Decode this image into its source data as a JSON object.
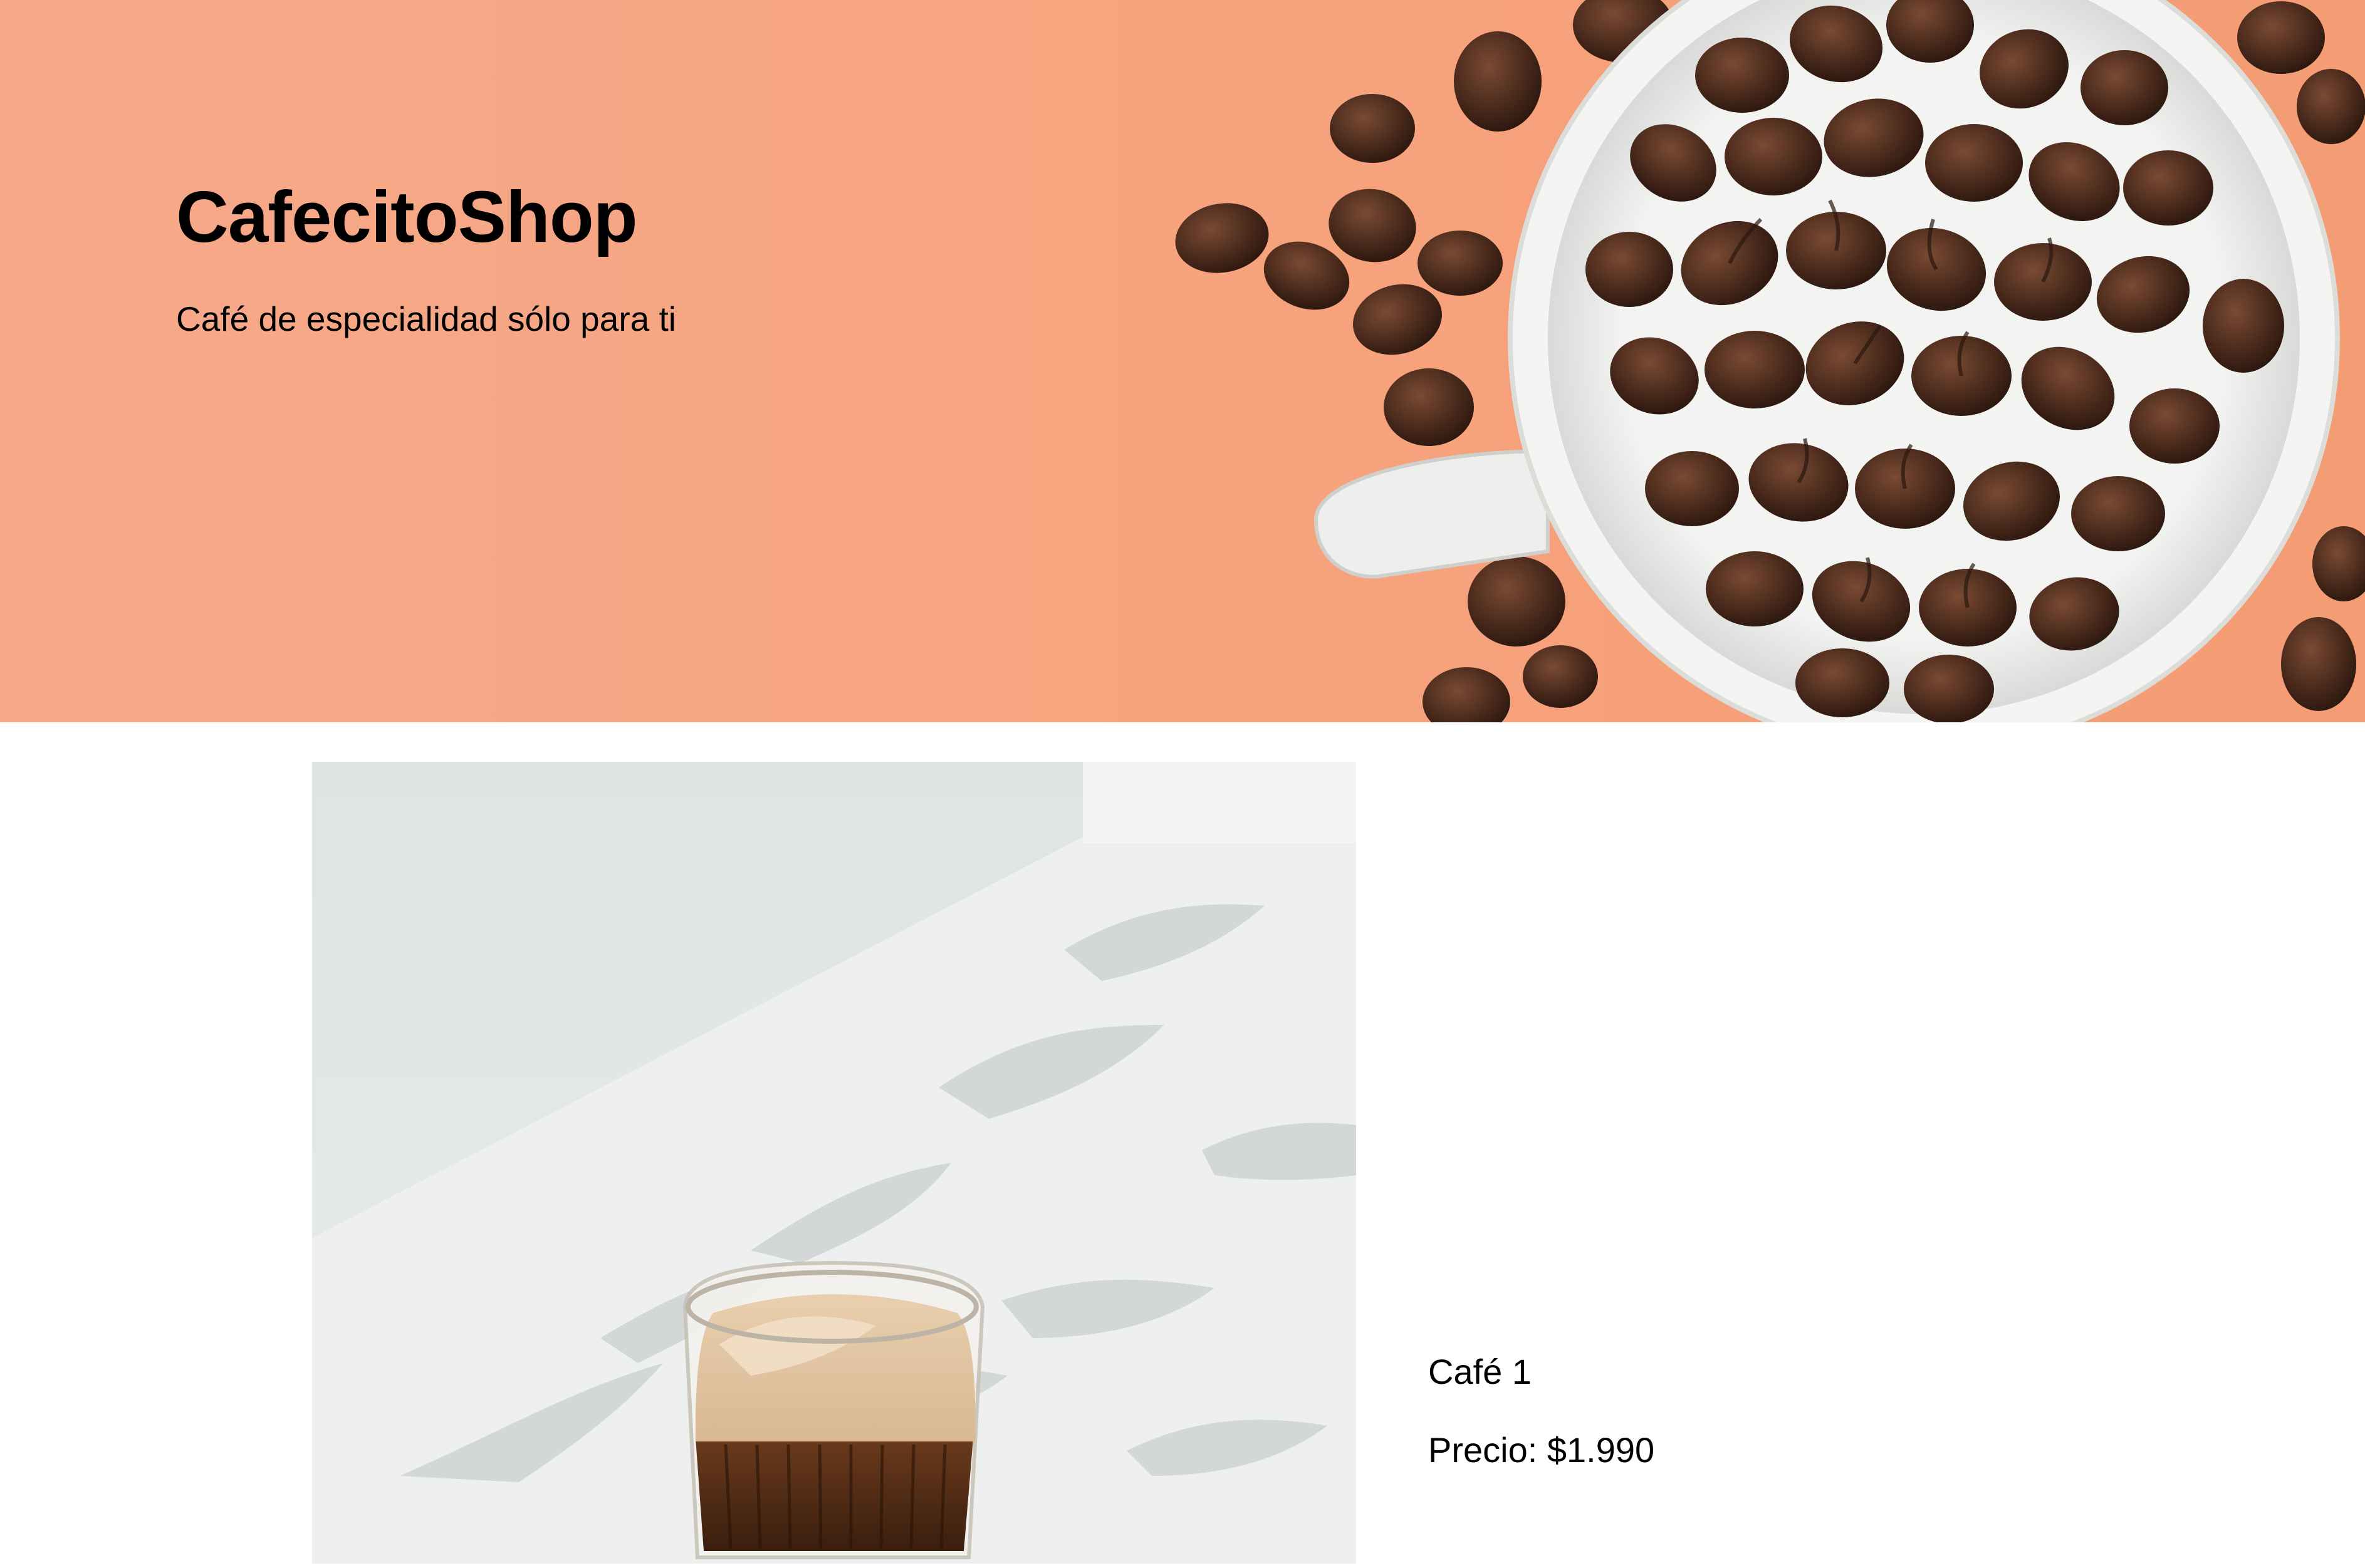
{
  "hero": {
    "title": "CafecitoShop",
    "subtitle": "Café de especialidad sólo para ti",
    "background_color": "#f6a582",
    "image": "coffee-beans-cup-image"
  },
  "product": {
    "image": "iced-latte-glass-image",
    "name": "Café 1",
    "price_label": "Precio:",
    "price": "$1.990"
  }
}
